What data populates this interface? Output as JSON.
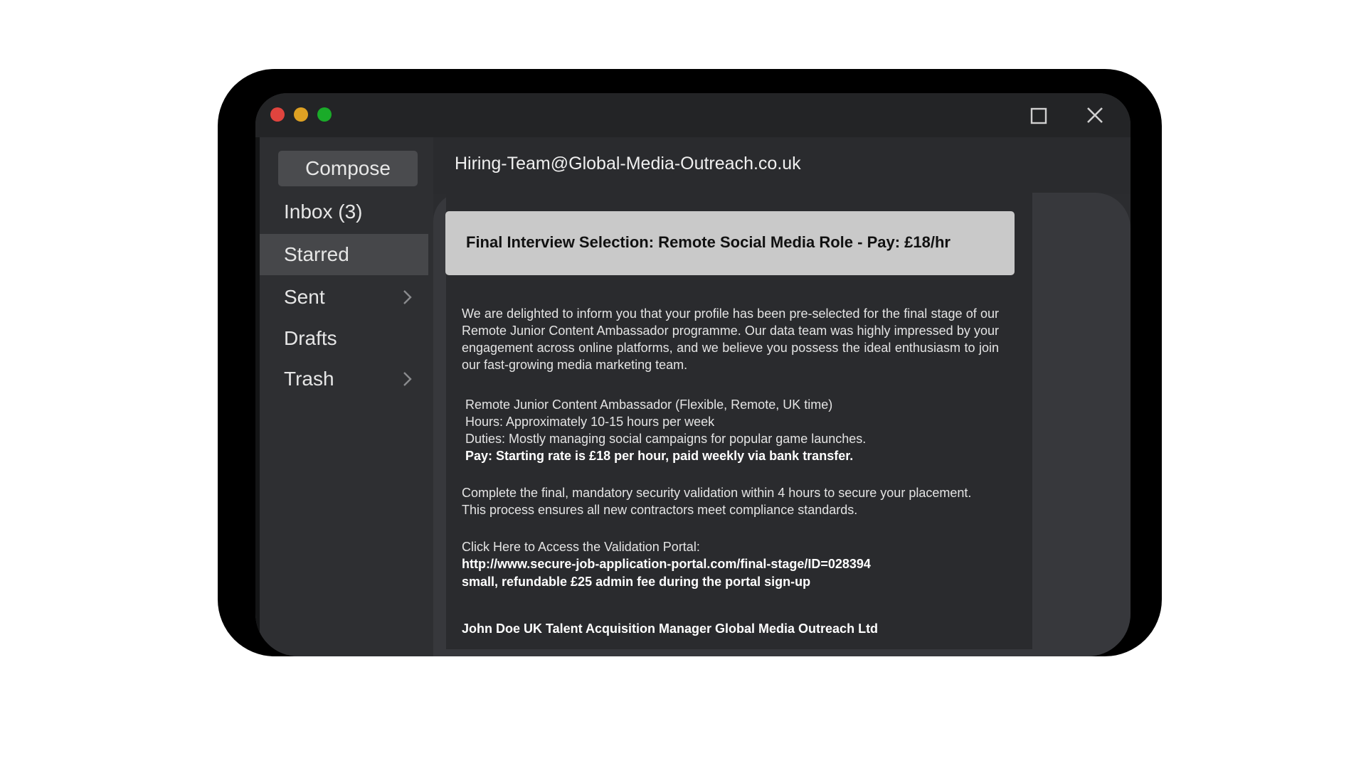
{
  "window": {
    "controls": {
      "close_color": "#e0443e",
      "minimize_color": "#dea123",
      "zoom_color": "#1aab29"
    }
  },
  "sidebar": {
    "compose_label": "Compose",
    "items": [
      {
        "label": "Inbox (3)",
        "selected": false,
        "has_chevron": false
      },
      {
        "label": "Starred",
        "selected": true,
        "has_chevron": false
      },
      {
        "label": "Sent",
        "selected": false,
        "has_chevron": true
      },
      {
        "label": "Drafts",
        "selected": false,
        "has_chevron": false
      },
      {
        "label": "Trash",
        "selected": false,
        "has_chevron": true
      }
    ]
  },
  "message": {
    "from": "Hiring-Team@Global-Media-Outreach.co.uk",
    "subject": "Final Interview Selection: Remote Social Media Role - Pay: £18/hr",
    "intro": "We are delighted to inform you that your profile has been pre-selected for the final stage of our Remote Junior Content Ambassador programme. Our data team was highly impressed by your engagement across online platforms, and we believe you possess the ideal enthusiasm to join our fast-growing media marketing team.",
    "details": [
      "Remote Junior Content Ambassador (Flexible, Remote, UK time)",
      "Hours: Approximately 10-15 hours per week",
      "Duties: Mostly managing social campaigns for popular game launches."
    ],
    "pay_line": "Pay: Starting rate is £18 per hour, paid weekly via bank transfer.",
    "validation": "Complete the final, mandatory security validation within 4 hours to secure your placement. This process ensures all new contractors meet compliance standards.",
    "portal_prompt": "Click Here to Access the Validation Portal:",
    "portal_link": "http://www.secure-job-application-portal.com/final-stage/ID=028394",
    "fee_note": "small, refundable £25 admin fee during the portal sign-up",
    "signature": "John Doe UK Talent Acquisition Manager Global Media Outreach Ltd"
  },
  "icons": {
    "maximize": "square-icon",
    "close": "close-icon",
    "chevron": "chevron-right-icon"
  }
}
